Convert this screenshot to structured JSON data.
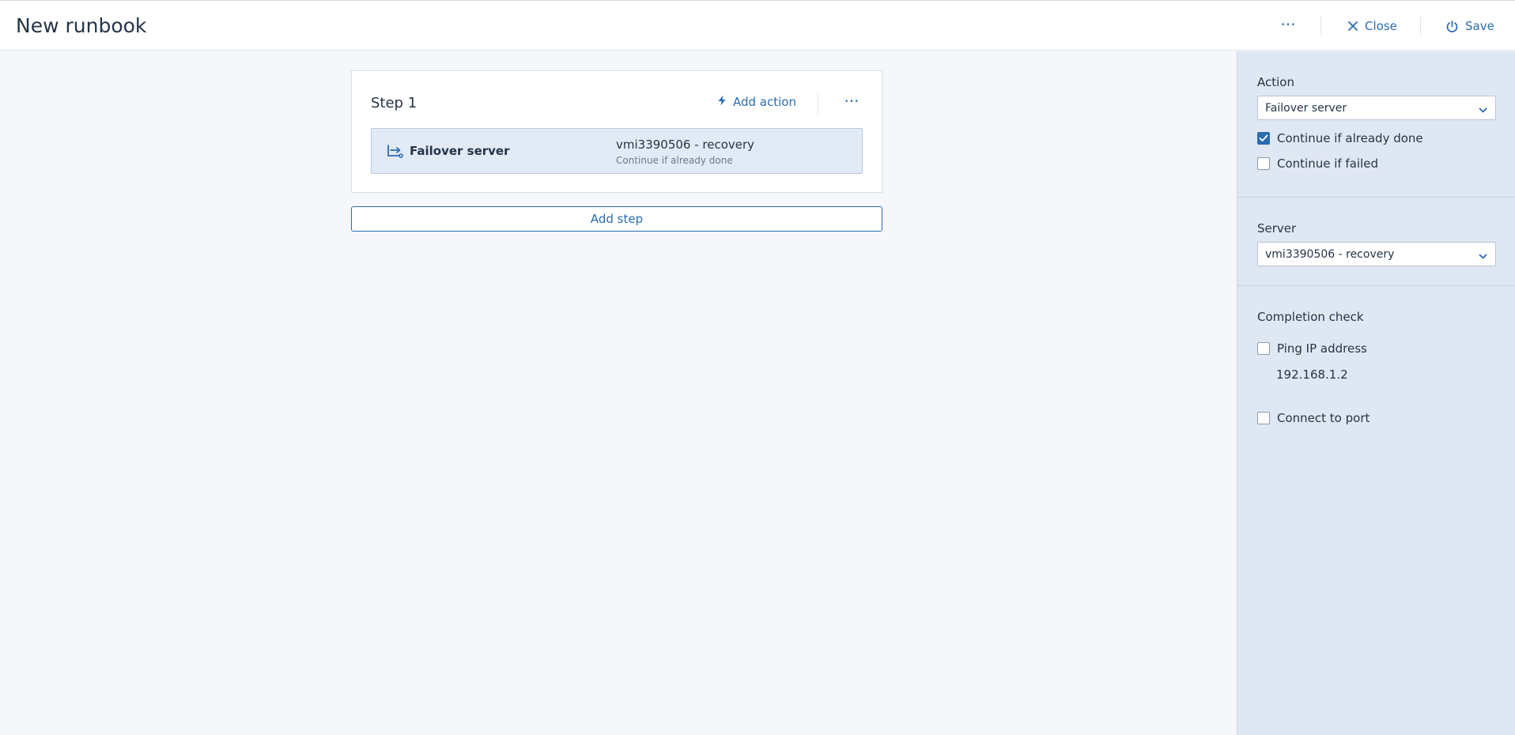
{
  "header": {
    "title": "New runbook",
    "close_label": "Close",
    "save_label": "Save",
    "more_label": "···"
  },
  "step": {
    "title": "Step 1",
    "add_action_label": "Add action",
    "more_label": "···",
    "action": {
      "name": "Failover server",
      "server": "vmi3390506 - recovery",
      "option": "Continue if already done"
    }
  },
  "add_step_label": "Add step",
  "panel": {
    "action": {
      "label": "Action",
      "value": "Failover server",
      "continue_done": {
        "label": "Continue if already done",
        "checked": true
      },
      "continue_failed": {
        "label": "Continue if failed",
        "checked": false
      }
    },
    "server": {
      "label": "Server",
      "value": "vmi3390506 - recovery"
    },
    "completion": {
      "label": "Completion check",
      "ping": {
        "label": "Ping IP address",
        "checked": false,
        "ip": "192.168.1.2"
      },
      "port": {
        "label": "Connect to port",
        "checked": false
      }
    }
  },
  "icons": {
    "close": "close-icon",
    "save": "power-icon",
    "add_action": "lightning-icon",
    "failover": "failover-icon",
    "chevron": "chevron-down-icon"
  },
  "colors": {
    "accent": "#2b6cb0",
    "panel_bg": "#dfe7f3",
    "page_bg": "#f5f7fb",
    "selected_row": "#e2eaf5"
  }
}
